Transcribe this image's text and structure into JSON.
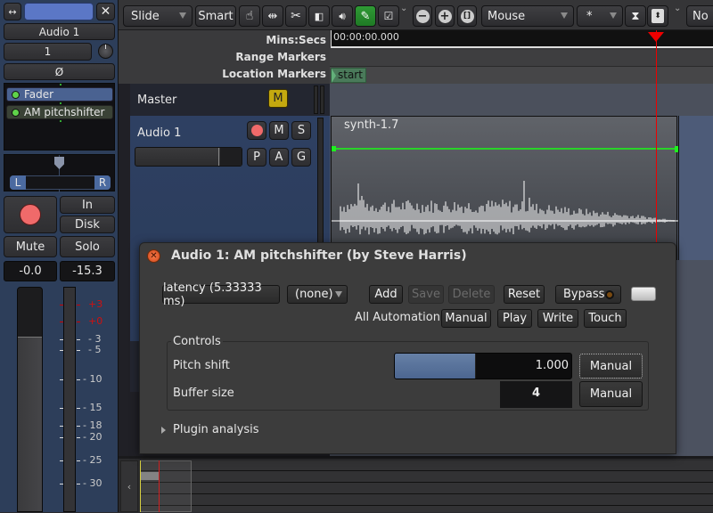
{
  "strip": {
    "name_color": "#5b77c6",
    "track_name": "Audio 1",
    "input_button": "1",
    "phase_button": "Ø",
    "processors": [
      {
        "label": "Fader",
        "active": true
      },
      {
        "label": "AM pitchshifter",
        "active": true
      }
    ],
    "panner": {
      "left_label": "L",
      "right_label": "R"
    },
    "in_button": "In",
    "disk_button": "Disk",
    "mute_button": "Mute",
    "solo_button": "Solo",
    "gain_display": "-0.0",
    "peak_display": "-15.3",
    "meter_scale": [
      "+3",
      "+0",
      "-3",
      "-5",
      "-10",
      "-15",
      "-18",
      "-20",
      "-25",
      "-30"
    ],
    "fader_level_db": 0.0
  },
  "toolbar": {
    "edit_mode": "Slide",
    "smart_button": "Smart",
    "tools": [
      "grab-tool",
      "range-tool",
      "cut-tool",
      "stretch-tool",
      "audition-tool",
      "draw-tool",
      "internal-edit-tool"
    ],
    "active_tool": "draw-tool",
    "zoom_buttons": [
      "zoom-out",
      "zoom-in",
      "zoom-to-session"
    ],
    "zoom_focus": "Mouse",
    "visible_tracks": "*",
    "grid_label": "No"
  },
  "ruler": {
    "labels": [
      "Mins:Secs",
      "Range Markers",
      "Location Markers"
    ],
    "timecode": "00:00:00.000",
    "start_marker": "start",
    "playhead_color": "#e00000"
  },
  "tracks": [
    {
      "name": "Master",
      "buttons": [
        "M"
      ]
    },
    {
      "name": "Audio 1",
      "buttons": [
        "rec",
        "M",
        "S",
        "P",
        "A",
        "G"
      ]
    }
  ],
  "region": {
    "name": "synth-1.7",
    "gain_line_color": "#29d329"
  },
  "dialog": {
    "title": "Audio 1: AM pitchshifter (by Steve Harris)",
    "latency_button": "latency (5.33333 ms)",
    "preset_select": "(none)",
    "add_button": "Add",
    "save_button": "Save",
    "delete_button": "Delete",
    "reset_button": "Reset",
    "bypass_button": "Bypass",
    "all_automation_label": "All Automation",
    "automation_buttons": [
      "Manual",
      "Play",
      "Write",
      "Touch"
    ],
    "controls_label": "Controls",
    "controls": [
      {
        "label": "Pitch shift",
        "value": "1.000",
        "fill_fraction": 0.46,
        "mode": "Manual"
      },
      {
        "label": "Buffer size",
        "value": "4",
        "mode": "Manual"
      }
    ],
    "plugin_analysis_label": "Plugin analysis"
  }
}
